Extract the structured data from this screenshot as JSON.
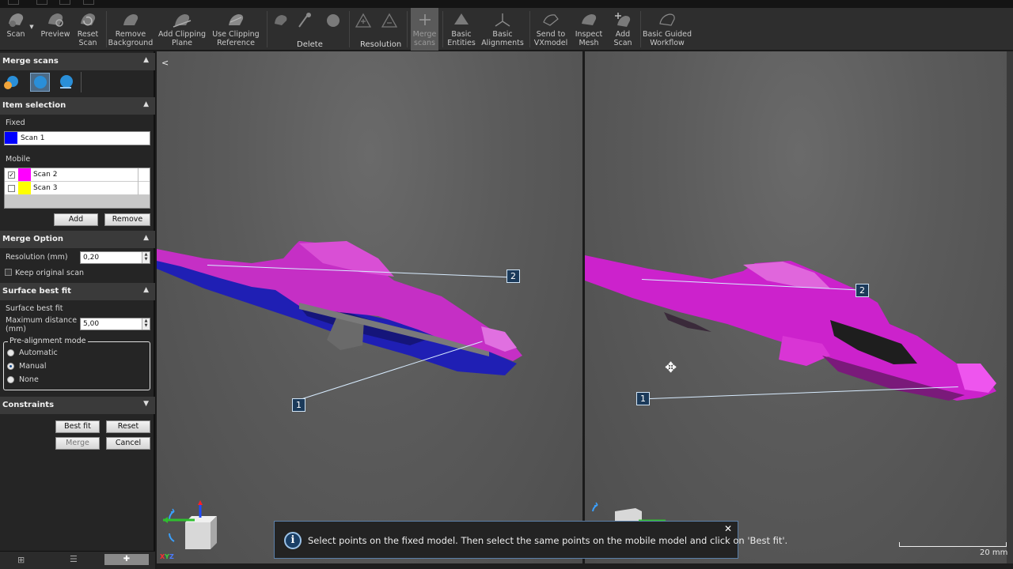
{
  "ribbon": {
    "scan_label": "Scan",
    "preview_label": "Preview",
    "reset_scan_label": "Reset\nScan",
    "remove_background_label": "Remove\nBackground",
    "add_clipping_plane_label": "Add Clipping\nPlane",
    "use_clipping_reference_label": "Use Clipping\nReference",
    "delete_group_label": "Delete",
    "resolution_group_label": "Resolution",
    "merge_scans_label": "Merge\nscans",
    "basic_entities_label": "Basic\nEntities",
    "basic_alignments_label": "Basic\nAlignments",
    "send_to_vxmodel_label": "Send to\nVXmodel",
    "inspect_mesh_label": "Inspect\nMesh",
    "add_scan_label": "Add\nScan",
    "basic_guided_workflow_label": "Basic Guided\nWorkflow"
  },
  "panel": {
    "merge_scans_title": "Merge scans",
    "item_selection_title": "Item selection",
    "fixed_label": "Fixed",
    "fixed_scan": {
      "name": "Scan 1",
      "color": "#0000ff"
    },
    "mobile_label": "Mobile",
    "mobile_scans": [
      {
        "name": "Scan 2",
        "color": "#ff00ff",
        "checked": true
      },
      {
        "name": "Scan 3",
        "color": "#ffff00",
        "checked": false
      }
    ],
    "add_button": "Add",
    "remove_button": "Remove",
    "merge_option_title": "Merge Option",
    "resolution_label": "Resolution (mm)",
    "resolution_value": "0,20",
    "keep_original_label": "Keep original scan",
    "surface_best_fit_title": "Surface best fit",
    "surface_best_fit_label": "Surface best fit",
    "max_distance_label": "Maximum distance\n(mm)",
    "max_distance_value": "5,00",
    "prealignment_title": "Pre-alignment mode",
    "prealignment_options": [
      "Automatic",
      "Manual",
      "None"
    ],
    "prealignment_selected": "Manual",
    "constraints_title": "Constraints",
    "best_fit_button": "Best fit",
    "reset_button": "Reset",
    "merge_button": "Merge",
    "cancel_button": "Cancel"
  },
  "viewport": {
    "left_markers": [
      "2",
      "1"
    ],
    "right_markers": [
      "2",
      "1"
    ],
    "scale_label": "20 mm",
    "axis_label": "XYZ"
  },
  "toast": {
    "message": "Select points on the fixed model. Then select the same points on the mobile model and click on 'Best fit'."
  },
  "colors": {
    "fixed_scan": "#1a1ad0",
    "mobile_scan": "#d21ed2",
    "accent": "#1b3a5a"
  }
}
